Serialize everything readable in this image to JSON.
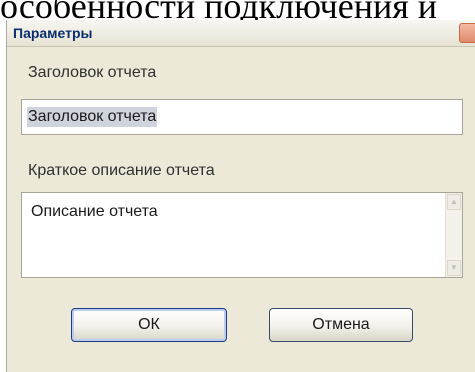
{
  "background_text": "особенности подключения и",
  "dialog": {
    "title": "Параметры",
    "report_title_label": "Заголовок отчета",
    "report_title_value": "Заголовок отчета",
    "description_label": "Краткое описание отчета",
    "description_value": "Описание отчета",
    "ok_label": "ОК",
    "cancel_label": "Отмена"
  },
  "icons": {
    "close": "close-icon",
    "scroll_up": "scroll-up-arrow-icon",
    "scroll_down": "scroll-down-arrow-icon"
  },
  "colors": {
    "window_bg": "#ece9d8",
    "title_text": "#0a2e6e",
    "button_border": "#1f3d7a",
    "selection": "#cfd3dc"
  }
}
